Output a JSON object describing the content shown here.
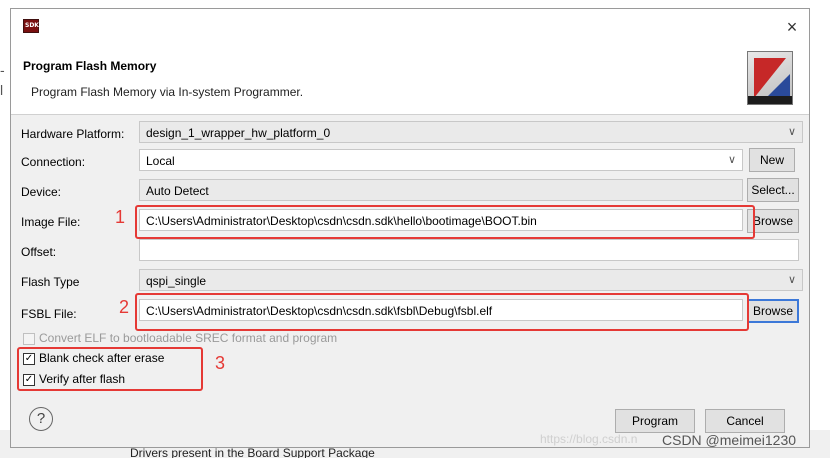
{
  "background": {
    "bottom_text": "Drivers present in the Board Support Package"
  },
  "dialog": {
    "app_icon": "SDK",
    "close_icon": "×",
    "title": "Program Flash Memory",
    "description": "Program Flash Memory via In-system Programmer."
  },
  "form": {
    "hardware_platform": {
      "label": "Hardware Platform:",
      "value": "design_1_wrapper_hw_platform_0"
    },
    "connection": {
      "label": "Connection:",
      "value": "Local",
      "new_button": "New"
    },
    "device": {
      "label": "Device:",
      "value": "Auto Detect",
      "select_button": "Select..."
    },
    "image_file": {
      "label": "Image File:",
      "value": "C:\\Users\\Administrator\\Desktop\\csdn\\csdn.sdk\\hello\\bootimage\\BOOT.bin",
      "browse_button": "Browse"
    },
    "offset": {
      "label": "Offset:",
      "value": ""
    },
    "flash_type": {
      "label": "Flash Type",
      "value": "qspi_single"
    },
    "fsbl_file": {
      "label": "FSBL File:",
      "value": "C:\\Users\\Administrator\\Desktop\\csdn\\csdn.sdk\\fsbl\\Debug\\fsbl.elf",
      "browse_button": "Browse"
    },
    "convert_elf": {
      "label": "Convert ELF to bootloadable SREC format and program",
      "checked": false,
      "enabled": false
    },
    "blank_check": {
      "label": "Blank check after erase",
      "checked": true
    },
    "verify": {
      "label": "Verify after flash",
      "checked": true
    }
  },
  "annotations": {
    "n1": "1",
    "n2": "2",
    "n3": "3"
  },
  "footer": {
    "help_icon": "?",
    "program_button": "Program",
    "cancel_button": "Cancel",
    "watermark_text": "https://blog.csdn.n",
    "csdn_credit": "CSDN @meimei1230"
  },
  "colors": {
    "annotation": "#e53935",
    "focus": "#3c78d8"
  }
}
